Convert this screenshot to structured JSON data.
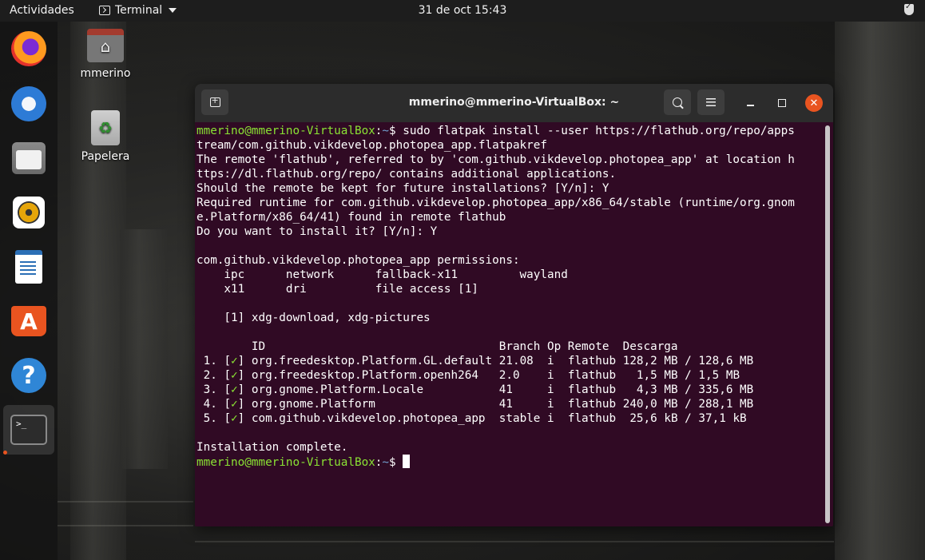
{
  "topbar": {
    "activities": "Actividades",
    "app_menu_label": "Terminal",
    "clock": "31 de oct  15:43",
    "tray_icon": "shield-check-icon"
  },
  "dock": {
    "items": [
      {
        "name": "firefox",
        "icon": "firefox-icon"
      },
      {
        "name": "thunderbird",
        "icon": "thunderbird-icon"
      },
      {
        "name": "files",
        "icon": "files-icon"
      },
      {
        "name": "rhythmbox",
        "icon": "rhythmbox-icon"
      },
      {
        "name": "libreoffice-writer",
        "icon": "writer-icon"
      },
      {
        "name": "software",
        "icon": "software-store-icon",
        "glyph": "A"
      },
      {
        "name": "help",
        "icon": "help-icon",
        "glyph": "?"
      },
      {
        "name": "terminal",
        "icon": "terminal-icon",
        "glyph": ">_",
        "active": true
      }
    ]
  },
  "desktop": {
    "icons": [
      {
        "label": "mmerino",
        "icon": "home-folder-icon"
      },
      {
        "label": "Papelera",
        "icon": "trash-icon"
      }
    ]
  },
  "window": {
    "title": "mmerino@mmerino-VirtualBox: ~",
    "accent": "#e95420",
    "background": "#300a24"
  },
  "terminal": {
    "prompt_user": "mmerino@mmerino-VirtualBox",
    "prompt_sep": ":",
    "prompt_path": "~",
    "prompt_symbol": "$ ",
    "command": "sudo flatpak install --user https://flathub.org/repo/apps",
    "command_cont": "tream/com.github.vikdevelop.photopea_app.flatpakref",
    "output_lines_1": [
      "The remote 'flathub', referred to by 'com.github.vikdevelop.photopea_app' at location h",
      "ttps://dl.flathub.org/repo/ contains additional applications.",
      "Should the remote be kept for future installations? [Y/n]: Y",
      "Required runtime for com.github.vikdevelop.photopea_app/x86_64/stable (runtime/org.gnom",
      "e.Platform/x86_64/41) found in remote flathub",
      "Do you want to install it? [Y/n]: Y",
      "",
      "com.github.vikdevelop.photopea_app permissions:",
      "    ipc      network      fallback-x11         wayland",
      "    x11      dri          file access [1]",
      "",
      "    [1] xdg-download, xdg-pictures",
      "",
      "        ID                                  Branch Op Remote  Descarga"
    ],
    "packages": [
      {
        "num": " 1. ",
        "id": "org.freedesktop.Platform.GL.default",
        "branch": "21.08 ",
        "op": "i",
        "remote": "flathub",
        "download": "128,2 MB / 128,6 MB"
      },
      {
        "num": " 2. ",
        "id": "org.freedesktop.Platform.openh264  ",
        "branch": "2.0   ",
        "op": "i",
        "remote": "flathub",
        "download": "  1,5 MB / 1,5 MB"
      },
      {
        "num": " 3. ",
        "id": "org.gnome.Platform.Locale          ",
        "branch": "41    ",
        "op": "i",
        "remote": "flathub",
        "download": "  4,3 MB / 335,6 MB"
      },
      {
        "num": " 4. ",
        "id": "org.gnome.Platform                 ",
        "branch": "41    ",
        "op": "i",
        "remote": "flathub",
        "download": "240,0 MB / 288,1 MB"
      },
      {
        "num": " 5. ",
        "id": "com.github.vikdevelop.photopea_app ",
        "branch": "stable",
        "op": "i",
        "remote": "flathub",
        "download": " 25,6 kB / 37,1 kB"
      }
    ],
    "check_mark": "✓",
    "completion": "Installation complete."
  }
}
